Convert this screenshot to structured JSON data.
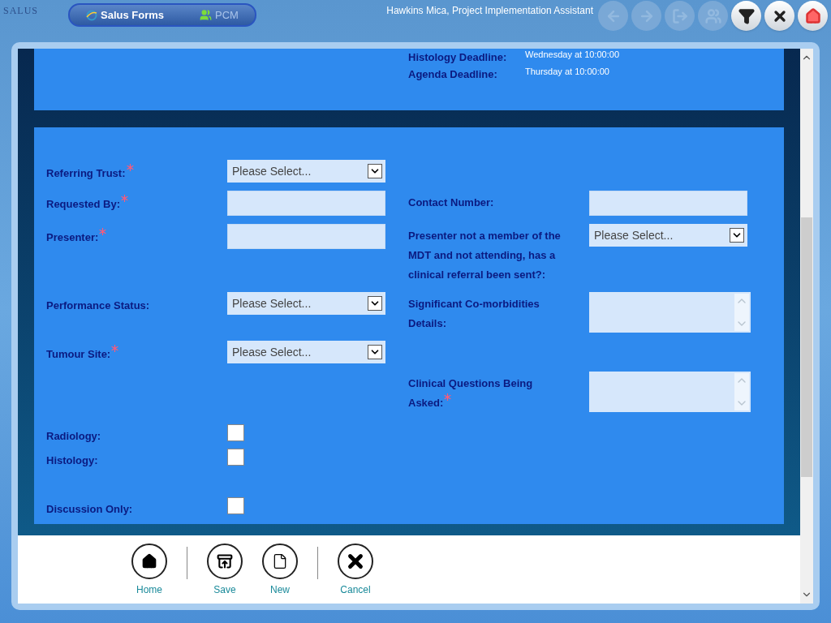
{
  "logo": "SALUS",
  "app_tabs": [
    {
      "label": "Salus Forms",
      "selected": true,
      "kind": "forms"
    },
    {
      "label": "PCM",
      "selected": false,
      "kind": "pcm"
    }
  ],
  "user": "Hawkins Mica, Project Implementation Assistant",
  "toolbar": [
    {
      "kind": "back",
      "disabled": true
    },
    {
      "kind": "forward",
      "disabled": true
    },
    {
      "kind": "exit",
      "disabled": true
    },
    {
      "kind": "users",
      "disabled": true
    },
    {
      "kind": "filter",
      "disabled": false
    },
    {
      "kind": "close",
      "disabled": false
    },
    {
      "kind": "home",
      "disabled": false
    }
  ],
  "deadlines": [
    {
      "label": "Histology Deadline:",
      "value": "Wednesday at 10:00:00"
    },
    {
      "label": "Agenda Deadline:",
      "value": "Thursday at 10:00:00"
    }
  ],
  "rows": [
    {
      "left": {
        "label": "Referring Trust:",
        "required": true,
        "kind": "select",
        "value": "Please Select..."
      },
      "right": null
    },
    {
      "left": {
        "label": "Requested By:",
        "required": true,
        "kind": "text"
      },
      "right": {
        "label": "Contact Number:",
        "required": false,
        "kind": "text"
      }
    },
    {
      "left": {
        "label": "Presenter:",
        "required": true,
        "kind": "text"
      },
      "right": {
        "label": "Presenter not a member of the MDT and not attending, has a clinical referral been sent?:",
        "required": false,
        "kind": "select",
        "value": "Please Select..."
      }
    },
    {
      "left": {
        "label": "Performance Status:",
        "required": false,
        "kind": "select",
        "value": "Please Select..."
      },
      "right": {
        "label": "Significant Co-morbidities Details:",
        "required": false,
        "kind": "textarea"
      }
    },
    {
      "left": {
        "label": "Tumour Site:",
        "required": true,
        "kind": "select",
        "value": "Please Select..."
      },
      "right": null
    },
    {
      "left": null,
      "right": {
        "label": "Clinical Questions Being Asked:",
        "required": true,
        "kind": "textarea"
      }
    },
    {
      "left": {
        "label": "Radiology:",
        "required": false,
        "kind": "checkbox",
        "checked": false
      },
      "right": null
    },
    {
      "left": {
        "label": "Histology:",
        "required": false,
        "kind": "checkbox",
        "checked": false
      },
      "right": null
    },
    {
      "left": {
        "label": "Discussion Only:",
        "required": false,
        "kind": "checkbox",
        "checked": false
      },
      "right": null
    }
  ],
  "actions": [
    {
      "label": "Home",
      "kind": "home"
    },
    {
      "label": "Save",
      "kind": "save"
    },
    {
      "label": "New",
      "kind": "new"
    },
    {
      "label": "Cancel",
      "kind": "cancel"
    }
  ]
}
